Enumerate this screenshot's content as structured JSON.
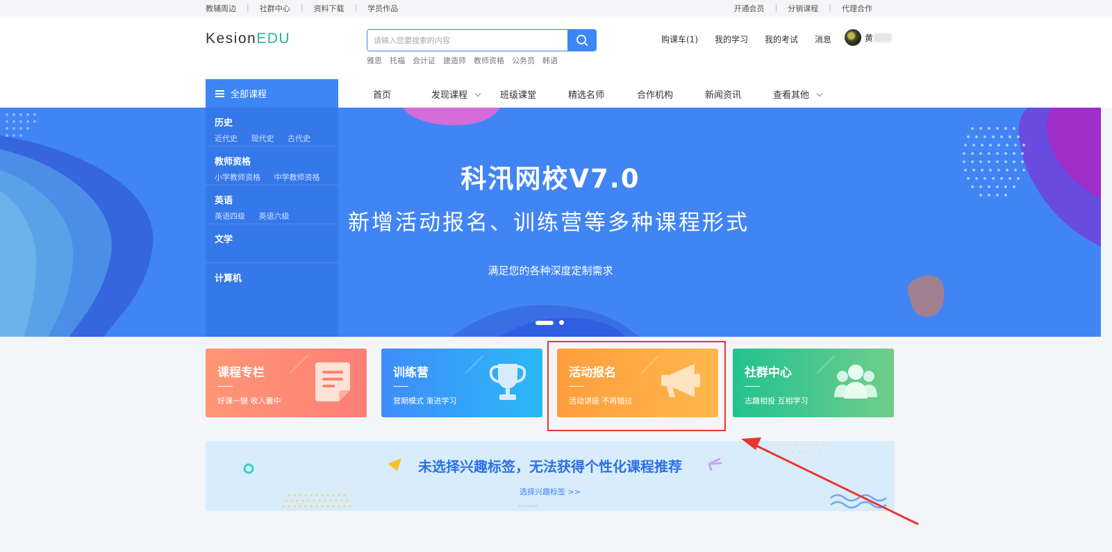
{
  "topbar": {
    "left_links": [
      "教辅周边",
      "社群中心",
      "资料下载",
      "学员作品"
    ],
    "right_links": [
      "开通会员",
      "分销课程",
      "代理合作"
    ]
  },
  "header": {
    "logo_main": "Kesion",
    "logo_accent": "EDU",
    "search_placeholder": "请输入您要搜索的内容",
    "hot_words": [
      "雅思",
      "托福",
      "会计证",
      "建造师",
      "教师资格",
      "公务员",
      "韩语"
    ],
    "user_links": [
      "购课车(1)",
      "我的学习",
      "我的考试",
      "消息"
    ],
    "user_name": "黄"
  },
  "nav": {
    "all_courses": "全部课程",
    "items": [
      "首页",
      "发现课程",
      "班级课堂",
      "精选名师",
      "合作机构",
      "新闻资讯",
      "查看其他"
    ]
  },
  "categories": [
    {
      "title": "历史",
      "subs": [
        "近代史",
        "现代史",
        "古代史"
      ]
    },
    {
      "title": "教师资格",
      "subs": [
        "小学教师资格",
        "中学教师资格"
      ]
    },
    {
      "title": "英语",
      "subs": [
        "英语四级",
        "英语六级"
      ]
    },
    {
      "title": "文学",
      "subs": []
    },
    {
      "title": "计算机",
      "subs": []
    }
  ],
  "banner": {
    "title": "科汛网校V7.0",
    "subtitle": "新增活动报名、训练营等多种课程形式",
    "desc": "满足您的各种深度定制需求",
    "slide_count": 2,
    "active_slide": 1
  },
  "cards": [
    {
      "title": "课程专栏",
      "desc": "好课一键 收入囊中",
      "icon": "document-icon"
    },
    {
      "title": "训练营",
      "desc": "营期模式 渐进学习",
      "icon": "trophy-icon"
    },
    {
      "title": "活动报名",
      "desc": "活动讲座 不再错过",
      "icon": "megaphone-icon"
    },
    {
      "title": "社群中心",
      "desc": "志趣相投 互相学习",
      "icon": "group-icon"
    }
  ],
  "interest": {
    "message": "未选择兴趣标签，无法获得个性化课程推荐",
    "link": "选择兴趣标签 >>"
  },
  "colors": {
    "primary": "#3d86f5",
    "annotation_red": "#e8352f"
  }
}
